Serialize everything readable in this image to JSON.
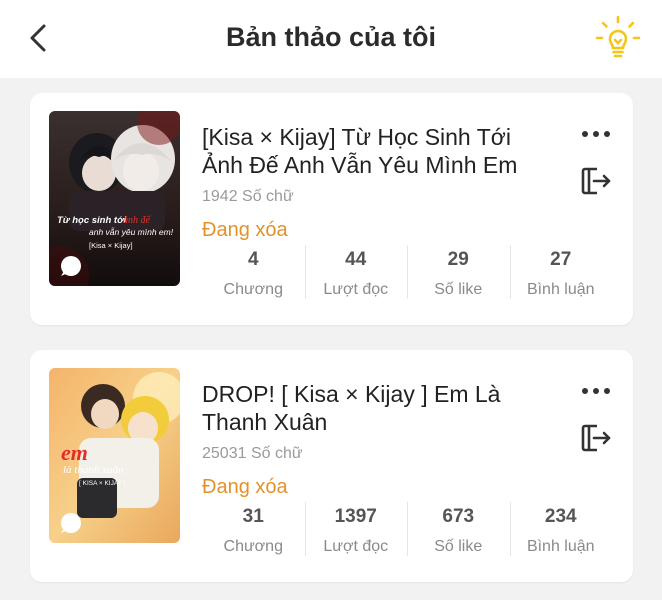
{
  "header": {
    "title": "Bản thảo của tôi",
    "back_icon": "chevron-left-icon",
    "tip_icon": "lightbulb-icon",
    "accent_color": "#f5c518"
  },
  "drafts": [
    {
      "title": "[Kisa × Kijay] Từ Học Sinh Tới Ảnh Đế Anh Vẫn Yêu Mình Em",
      "word_count": "1942 Số chữ",
      "status": "Đang xóa",
      "stats": [
        {
          "value": "4",
          "label": "Chương"
        },
        {
          "value": "44",
          "label": "Lượt đọc"
        },
        {
          "value": "29",
          "label": "Số like"
        },
        {
          "value": "27",
          "label": "Bình luận"
        }
      ],
      "cover_text": "Từ học sinh tới ảnh đế anh vẫn yêu mình em! [Kisa × Kijay]"
    },
    {
      "title": "DROP! [ Kisa × Kijay ] Em Là Thanh Xuân",
      "word_count": "25031 Số chữ",
      "status": "Đang xóa",
      "stats": [
        {
          "value": "31",
          "label": "Chương"
        },
        {
          "value": "1397",
          "label": "Lượt đọc"
        },
        {
          "value": "673",
          "label": "Số like"
        },
        {
          "value": "234",
          "label": "Bình luận"
        }
      ],
      "cover_text": "em là thanh xuân [ KISA × KIJAY ]"
    }
  ],
  "status_color": "#e3922a"
}
